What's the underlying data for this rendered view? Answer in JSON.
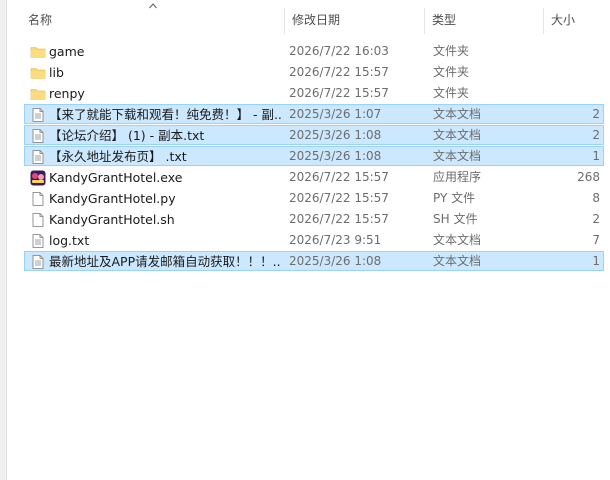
{
  "columns": {
    "name": "名称",
    "date": "修改日期",
    "type": "类型",
    "size": "大小"
  },
  "files": [
    {
      "icon": "folder-icon",
      "name": "game",
      "date": "2026/7/22 16:03",
      "type": "文件夹",
      "size": "",
      "selected": false
    },
    {
      "icon": "folder-icon",
      "name": "lib",
      "date": "2026/7/22 15:57",
      "type": "文件夹",
      "size": "",
      "selected": false
    },
    {
      "icon": "folder-icon",
      "name": "renpy",
      "date": "2026/7/22 15:57",
      "type": "文件夹",
      "size": "",
      "selected": false
    },
    {
      "icon": "text-file-icon",
      "name": "【来了就能下载和观看！纯免费！】 - 副...",
      "date": "2025/3/26 1:07",
      "type": "文本文档",
      "size": "2",
      "selected": true
    },
    {
      "icon": "text-file-icon",
      "name": "【论坛介绍】 (1) - 副本.txt",
      "date": "2025/3/26 1:08",
      "type": "文本文档",
      "size": "2",
      "selected": true
    },
    {
      "icon": "text-file-icon",
      "name": "【永久地址发布页】 .txt",
      "date": "2025/3/26 1:08",
      "type": "文本文档",
      "size": "1",
      "selected": true
    },
    {
      "icon": "app-icon",
      "name": "KandyGrantHotel.exe",
      "date": "2026/7/22 15:57",
      "type": "应用程序",
      "size": "268",
      "selected": false
    },
    {
      "icon": "file-icon",
      "name": "KandyGrantHotel.py",
      "date": "2026/7/22 15:57",
      "type": "PY 文件",
      "size": "8",
      "selected": false
    },
    {
      "icon": "file-icon",
      "name": "KandyGrantHotel.sh",
      "date": "2026/7/22 15:57",
      "type": "SH 文件",
      "size": "2",
      "selected": false
    },
    {
      "icon": "text-file-icon",
      "name": "log.txt",
      "date": "2026/7/23 9:51",
      "type": "文本文档",
      "size": "7",
      "selected": false
    },
    {
      "icon": "text-file-icon",
      "name": "最新地址及APP请发邮箱自动获取！！！...",
      "date": "2025/3/26 1:08",
      "type": "文本文档",
      "size": "1",
      "selected": true
    }
  ],
  "colors": {
    "selection_bg": "#cce8ff",
    "selection_border": "#99d1ff",
    "folder": "#f8d775"
  }
}
